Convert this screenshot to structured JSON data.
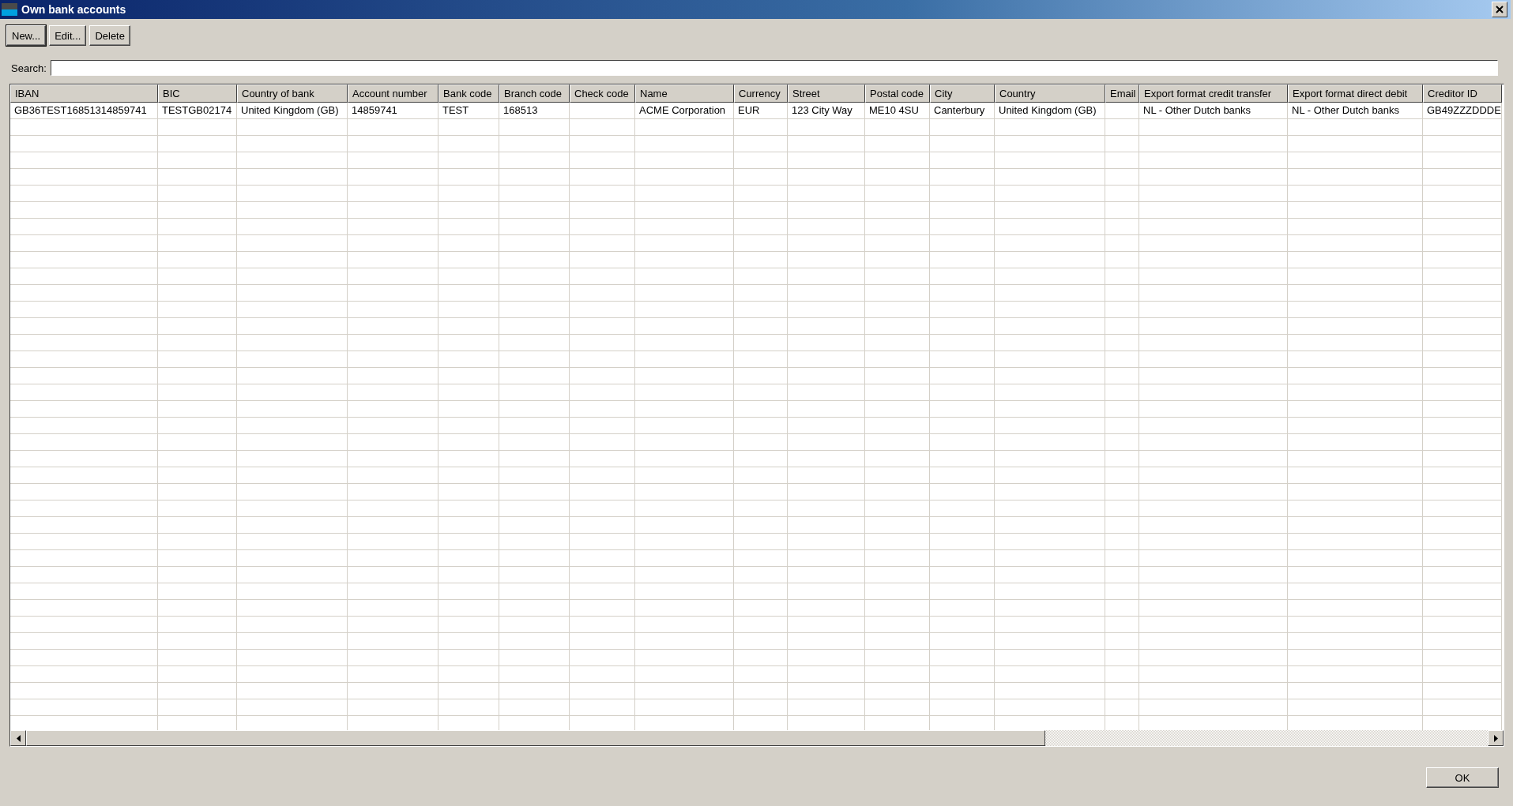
{
  "window": {
    "title": "Own bank accounts"
  },
  "toolbar": {
    "buttons": [
      {
        "label": "New...",
        "focused": true
      },
      {
        "label": "Edit...",
        "focused": false
      },
      {
        "label": "Delete",
        "focused": false
      }
    ]
  },
  "search": {
    "label": "Search:"
  },
  "table": {
    "columns": [
      "IBAN",
      "BIC",
      "Country of bank",
      "Account number",
      "Bank code",
      "Branch code",
      "Check code",
      "Name",
      "Currency",
      "Street",
      "Postal code",
      "City",
      "Country",
      "Email",
      "Export format credit transfer",
      "Export format direct debit",
      "Creditor ID"
    ],
    "rows": [
      [
        "GB36TEST16851314859741",
        "TESTGB02174",
        "United Kingdom (GB)",
        "14859741",
        "TEST",
        "168513",
        "",
        "ACME Corporation",
        "EUR",
        "123 City Way",
        "ME10 4SU",
        "Canterbury",
        "United Kingdom (GB)",
        "",
        "NL - Other Dutch banks",
        "NL - Other Dutch banks",
        "GB49ZZZDDDE"
      ]
    ]
  },
  "buttons": [
    {
      "label": "OK"
    }
  ]
}
